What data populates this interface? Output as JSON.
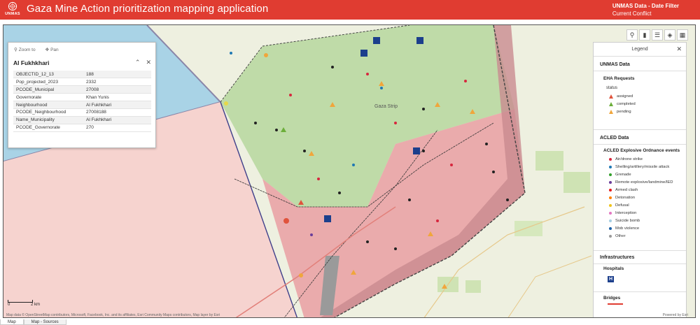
{
  "header": {
    "org_logo_text": "UNMAS",
    "title": "Gaza Mine Action prioritization mapping application",
    "filter_title": "UNMAS Data - Date Filter",
    "filter_value": "Current Conflict"
  },
  "attribute_panel": {
    "zoom_to_label": "Zoom to",
    "pan_label": "Pan",
    "feature_title": "Al Fukhkhari",
    "fields": [
      {
        "key": "OBJECTID_12_13",
        "value": "188"
      },
      {
        "key": "Pop_projected_2023",
        "value": "2332"
      },
      {
        "key": "PCODE_Municipal",
        "value": "27008"
      },
      {
        "key": "Governorate",
        "value": "Khan Yunis"
      },
      {
        "key": "Neighbourhood",
        "value": "Al Fukhkhari"
      },
      {
        "key": "PCODE_Neighbourhood",
        "value": "27008188"
      },
      {
        "key": "Name_Municipality",
        "value": "Al Fukhkhari"
      },
      {
        "key": "PCODE_Governorate",
        "value": "270"
      }
    ]
  },
  "map": {
    "place_label": "Gaza Strip",
    "scale_label": "2 km",
    "scale_zero": "0",
    "attribution": "Map data © OpenStreetMap contributors, Microsoft, Facebook, Inc. and its affiliates, Esri Community Maps contributors, Map layer by Esri",
    "powered_by": "Powered by Esri"
  },
  "legend": {
    "title": "Legend",
    "unmas_section": "UNMAS Data",
    "eha_title": "EHA Requests",
    "status_label": "status",
    "status_items": [
      {
        "label": "assigned",
        "color": "#e0533c"
      },
      {
        "label": "completed",
        "color": "#6cae3a"
      },
      {
        "label": "pending",
        "color": "#f0a63c"
      }
    ],
    "acled_section": "ACLED Data",
    "acled_title": "ACLED Explosive Ordnance events",
    "acled_items": [
      {
        "label": "Air/drone strike",
        "color": "#d7263d"
      },
      {
        "label": "Shelling/artillery/missile attack",
        "color": "#1f78b4"
      },
      {
        "label": "Grenade",
        "color": "#33a02c"
      },
      {
        "label": "Remote explosive/landmine/IED",
        "color": "#6a3d9a"
      },
      {
        "label": "Armed clash",
        "color": "#e31a1c"
      },
      {
        "label": "Detonation",
        "color": "#ff7f00"
      },
      {
        "label": "Defusal",
        "color": "#f0c419"
      },
      {
        "label": "Interception",
        "color": "#e377c2"
      },
      {
        "label": "Suicide bomb",
        "color": "#a6cee3"
      },
      {
        "label": "Mob violence",
        "color": "#1a5fa6"
      },
      {
        "label": "Other",
        "color": "#999999"
      }
    ],
    "infra_section": "Infrastructures",
    "hospitals_label": "Hospitals",
    "bridges_label": "Bridges"
  },
  "tabs": [
    {
      "label": "Map"
    },
    {
      "label": "Map - Sources"
    }
  ]
}
